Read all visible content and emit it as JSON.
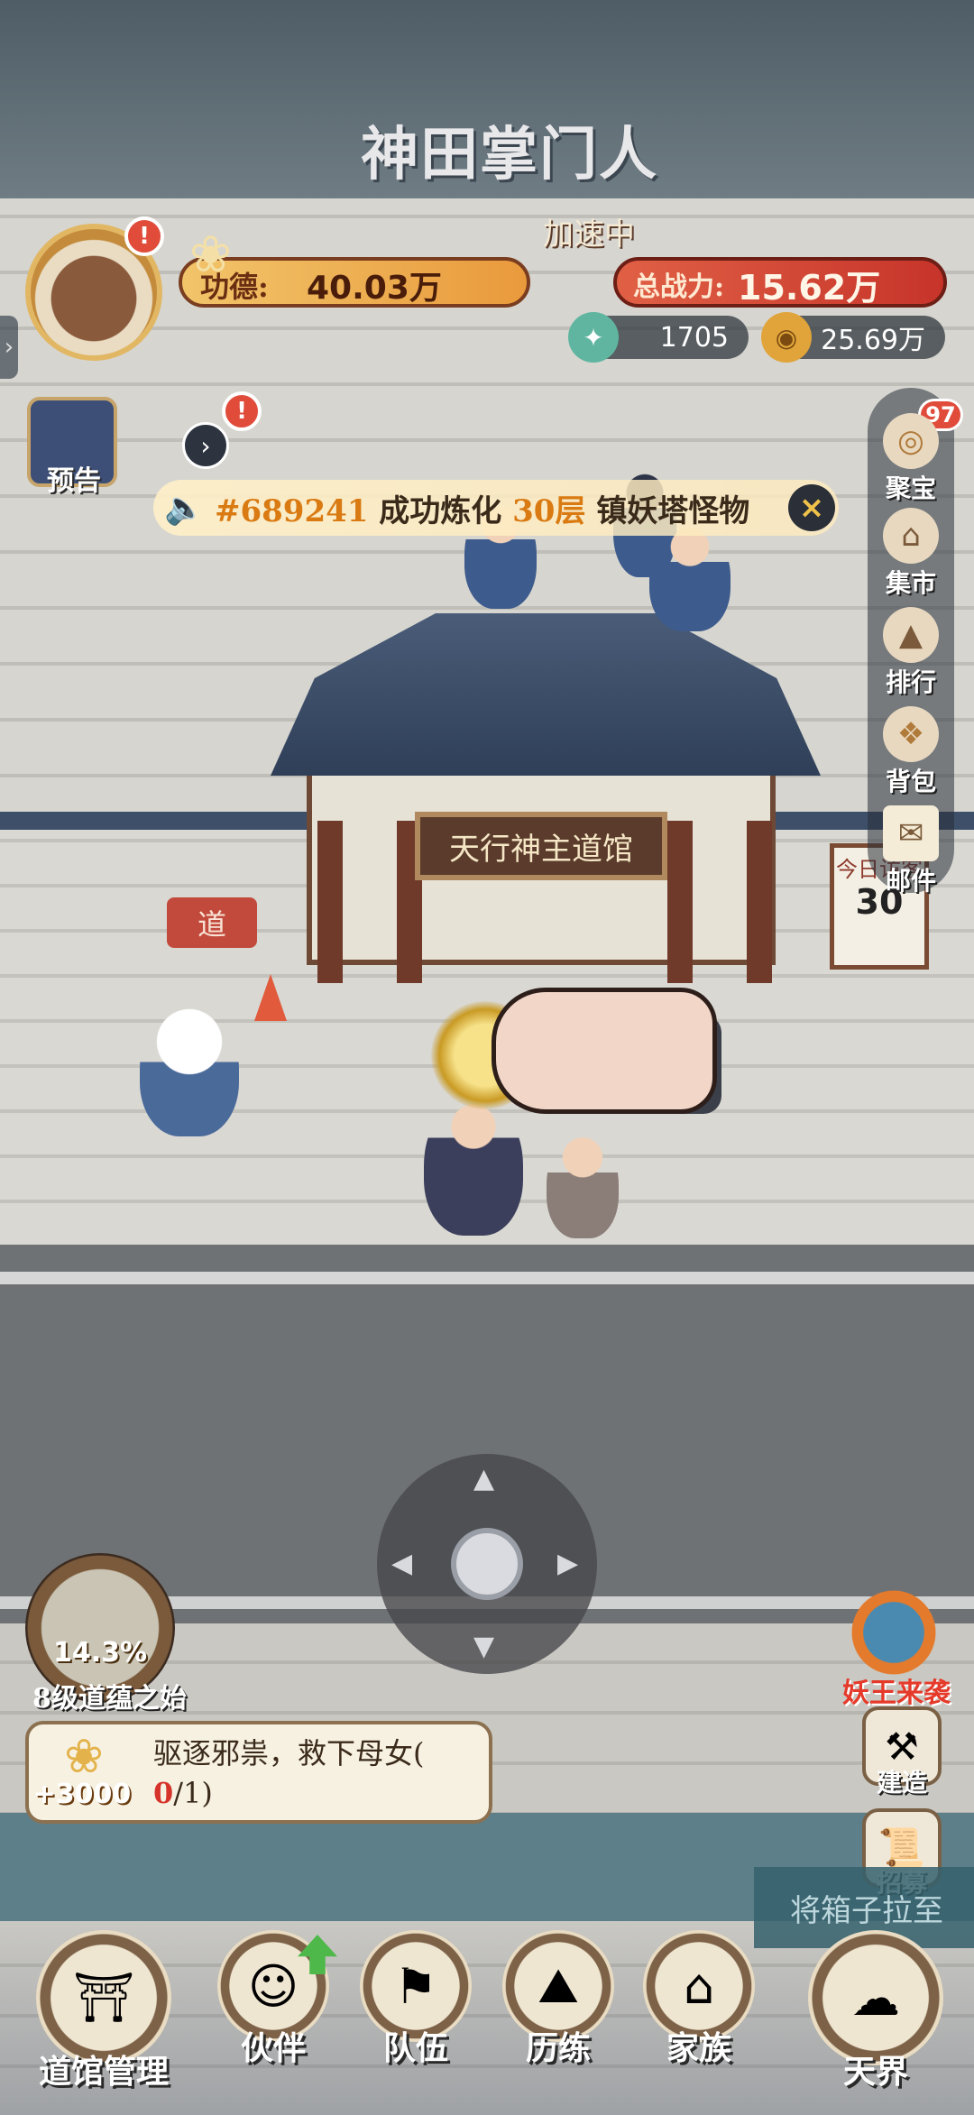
{
  "game": {
    "title": "神田掌门人"
  },
  "hud": {
    "alert_mark": "!",
    "merit": {
      "label": "功德:",
      "value": "40.03万"
    },
    "speed_status": "加速中",
    "power": {
      "label": "总战力:",
      "value": "15.62万"
    },
    "jade": {
      "value": "1705"
    },
    "coins": {
      "value": "25.69万"
    }
  },
  "side_tab": {
    "label": "›"
  },
  "preview": {
    "label": "预告"
  },
  "expand": {
    "label": "›"
  },
  "broadcast": {
    "player_id": "#689241",
    "text1": "成功炼化",
    "floors": "30层",
    "text2": "镇妖塔怪物",
    "close": "×"
  },
  "scene": {
    "temple_sign": "天行神主道馆",
    "dao_sign": "道",
    "visitors": {
      "label": "今日访客",
      "count": "30"
    }
  },
  "right_menu": {
    "badge": "97",
    "items": [
      {
        "label": "聚宝",
        "icon": "treasure-icon"
      },
      {
        "label": "集市",
        "icon": "market-icon"
      },
      {
        "label": "排行",
        "icon": "ranking-icon"
      },
      {
        "label": "背包",
        "icon": "bag-icon"
      },
      {
        "label": "邮件",
        "icon": "mail-icon"
      }
    ]
  },
  "level": {
    "percent": "14.3%",
    "name": "8级道蕴之始"
  },
  "quest": {
    "reward": "+3000",
    "text": "驱逐邪祟，救下母女(",
    "progress_current": "0",
    "progress_total": "/1)"
  },
  "right_actions": {
    "event": "妖王来袭",
    "build": "建造",
    "recruit": "招募"
  },
  "hint": "将箱子拉至",
  "bottom_nav": [
    {
      "label": "道馆管理",
      "icon": "daoguan-icon"
    },
    {
      "label": "伙伴",
      "icon": "partner-icon"
    },
    {
      "label": "队伍",
      "icon": "team-icon"
    },
    {
      "label": "历练",
      "icon": "training-icon"
    },
    {
      "label": "家族",
      "icon": "clan-icon"
    },
    {
      "label": "天界",
      "icon": "heaven-icon"
    }
  ],
  "colors": {
    "accent": "#e2b764",
    "alert": "#e04b3a",
    "merit": "#f2c46a",
    "power": "#c7342a"
  }
}
